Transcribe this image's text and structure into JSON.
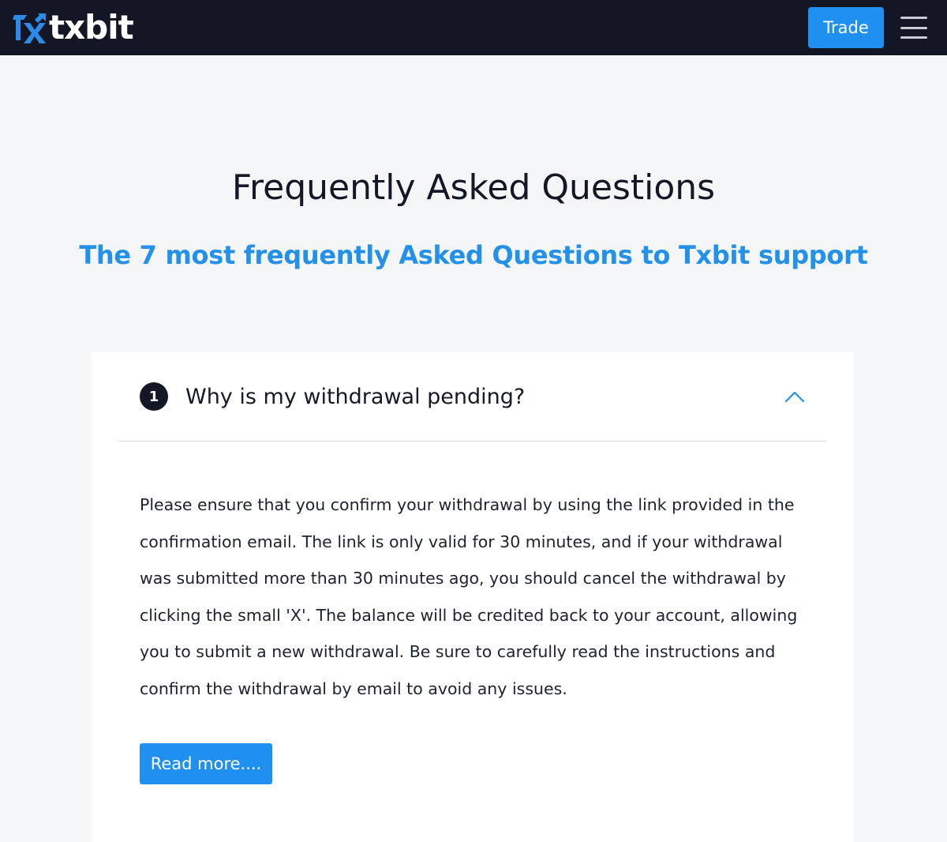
{
  "header": {
    "brand_name": "txbit",
    "logo_icon": "txbit-logo-icon",
    "trade_label": "Trade",
    "menu_icon": "hamburger-menu-icon"
  },
  "hero": {
    "title": "Frequently Asked Questions",
    "subtitle": "The 7 most frequently Asked Questions to Txbit support"
  },
  "faq": {
    "items": [
      {
        "number": "1",
        "question": "Why is my withdrawal pending?",
        "expanded": true,
        "toggle_icon": "chevron-up-icon",
        "answer": "Please ensure that you confirm your withdrawal by using the link provided in the confirmation email. The link is only valid for 30 minutes, and if your withdrawal was submitted more than 30 minutes ago, you should cancel the withdrawal by clicking the small 'X'. The balance will be credited back to your account, allowing you to submit a new withdrawal. Be sure to carefully read the instructions and confirm the withdrawal by email to avoid any issues.",
        "read_more_label": "Read more...."
      }
    ]
  },
  "colors": {
    "navbar_bg": "#131725",
    "accent_blue": "#1f8ff0",
    "subtitle_blue": "#2390ea",
    "page_bg": "#f5f6f8",
    "card_bg": "#ffffff",
    "text_dark": "#141826"
  }
}
